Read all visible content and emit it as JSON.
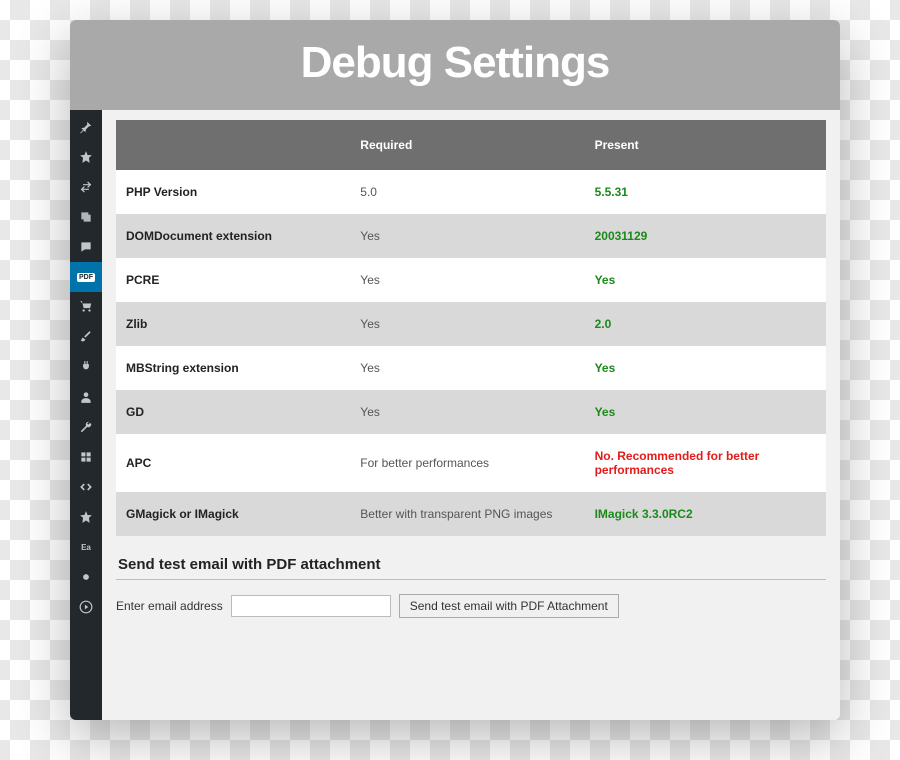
{
  "title": "Debug Settings",
  "table": {
    "headers": [
      "",
      "Required",
      "Present"
    ],
    "rows": [
      {
        "name": "PHP Version",
        "required": "5.0",
        "present": "5.5.31",
        "status": "ok"
      },
      {
        "name": "DOMDocument extension",
        "required": "Yes",
        "present": "20031129",
        "status": "ok"
      },
      {
        "name": "PCRE",
        "required": "Yes",
        "present": "Yes",
        "status": "ok"
      },
      {
        "name": "Zlib",
        "required": "Yes",
        "present": "2.0",
        "status": "ok"
      },
      {
        "name": "MBString extension",
        "required": "Yes",
        "present": "Yes",
        "status": "ok"
      },
      {
        "name": "GD",
        "required": "Yes",
        "present": "Yes",
        "status": "ok"
      },
      {
        "name": "APC",
        "required": "For better performances",
        "present": "No. Recommended for better performances",
        "status": "bad"
      },
      {
        "name": "GMagick or IMagick",
        "required": "Better with transparent PNG images",
        "present": "IMagick 3.3.0RC2",
        "status": "ok"
      }
    ]
  },
  "email_section": {
    "heading": "Send test email with PDF attachment",
    "input_label": "Enter email address",
    "button_label": "Send test email with PDF Attachment"
  },
  "sidebar": {
    "active_index": 5,
    "items": [
      "pin-icon",
      "star-icon",
      "switch-icon",
      "stack-icon",
      "comment-icon",
      "pdf-icon",
      "cart-icon",
      "brush-icon",
      "plug-icon",
      "user-icon",
      "wrench-icon",
      "grid-icon",
      "code-icon",
      "star2-icon",
      "ea-icon",
      "misc-icon",
      "play-icon"
    ]
  }
}
